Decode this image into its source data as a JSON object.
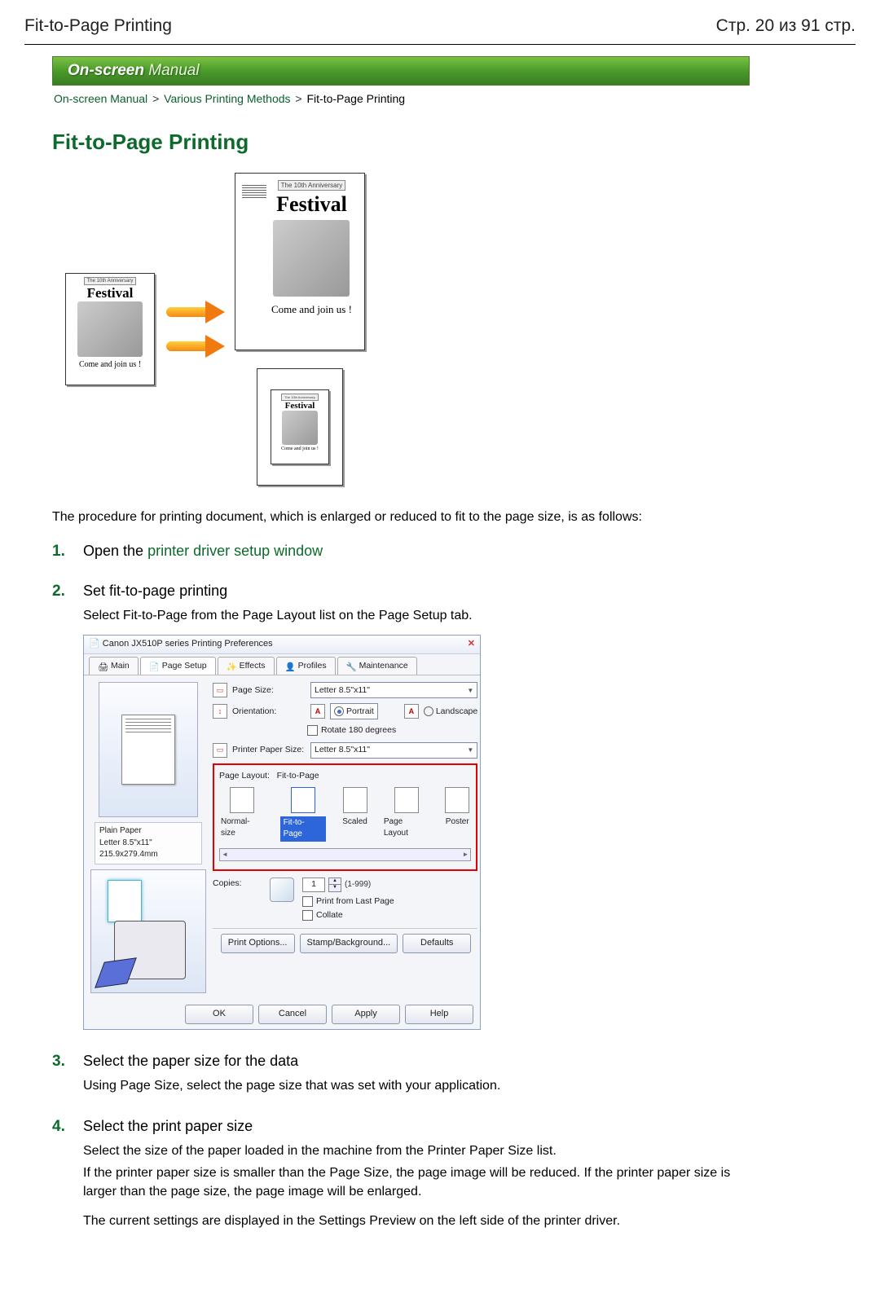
{
  "header": {
    "title": "Fit-to-Page Printing",
    "page_indicator": "Стр. 20 из 91 стр."
  },
  "banner": {
    "strong": "On-screen",
    "light": " Manual"
  },
  "breadcrumb": {
    "link1": "On-screen Manual",
    "link2": "Various Printing Methods",
    "current": "Fit-to-Page Printing"
  },
  "page_title": "Fit-to-Page Printing",
  "illustration": {
    "anniv": "The 10th Anniversary",
    "festival": "Festival",
    "join": "Come and join us !"
  },
  "intro": "The procedure for printing document, which is enlarged or reduced to fit to the page size, is as follows:",
  "steps": {
    "s1": {
      "prefix": "Open the ",
      "link": "printer driver setup window"
    },
    "s2": {
      "head": "Set fit-to-page printing",
      "body": "Select Fit-to-Page from the Page Layout list on the Page Setup tab."
    },
    "s3": {
      "head": "Select the paper size for the data",
      "body": "Using Page Size, select the page size that was set with your application."
    },
    "s4": {
      "head": "Select the print paper size",
      "p1": "Select the size of the paper loaded in the machine from the Printer Paper Size list.",
      "p2": "If the printer paper size is smaller than the Page Size, the page image will be reduced. If the printer paper size is larger than the page size, the page image will be enlarged.",
      "p3": "The current settings are displayed in the Settings Preview on the left side of the printer driver."
    }
  },
  "dialog": {
    "title": "Canon JX510P series Printing Preferences",
    "close": "✕",
    "tabs": {
      "main": "Main",
      "page_setup": "Page Setup",
      "effects": "Effects",
      "profiles": "Profiles",
      "maintenance": "Maintenance"
    },
    "labels": {
      "page_size": "Page Size:",
      "orientation": "Orientation:",
      "portrait": "Portrait",
      "landscape": "Landscape",
      "rotate": "Rotate 180 degrees",
      "printer_paper_size": "Printer Paper Size:",
      "page_layout": "Page Layout:",
      "page_layout_val": "Fit-to-Page",
      "copies": "Copies:",
      "copies_val": "1",
      "copies_range": "(1-999)",
      "print_from_last": "Print from Last Page",
      "collate": "Collate"
    },
    "values": {
      "page_size": "Letter 8.5\"x11\"",
      "printer_paper_size": "Letter 8.5\"x11\""
    },
    "preview": {
      "media": "Plain Paper",
      "dims": "Letter 8.5\"x11\" 215.9x279.4mm"
    },
    "layout_options": {
      "normal": "Normal-size",
      "fit": "Fit-to-Page",
      "scaled": "Scaled",
      "page_layout": "Page Layout",
      "poster": "Poster"
    },
    "buttons": {
      "print_options": "Print Options...",
      "stamp": "Stamp/Background...",
      "defaults": "Defaults",
      "ok": "OK",
      "cancel": "Cancel",
      "apply": "Apply",
      "help": "Help"
    }
  }
}
